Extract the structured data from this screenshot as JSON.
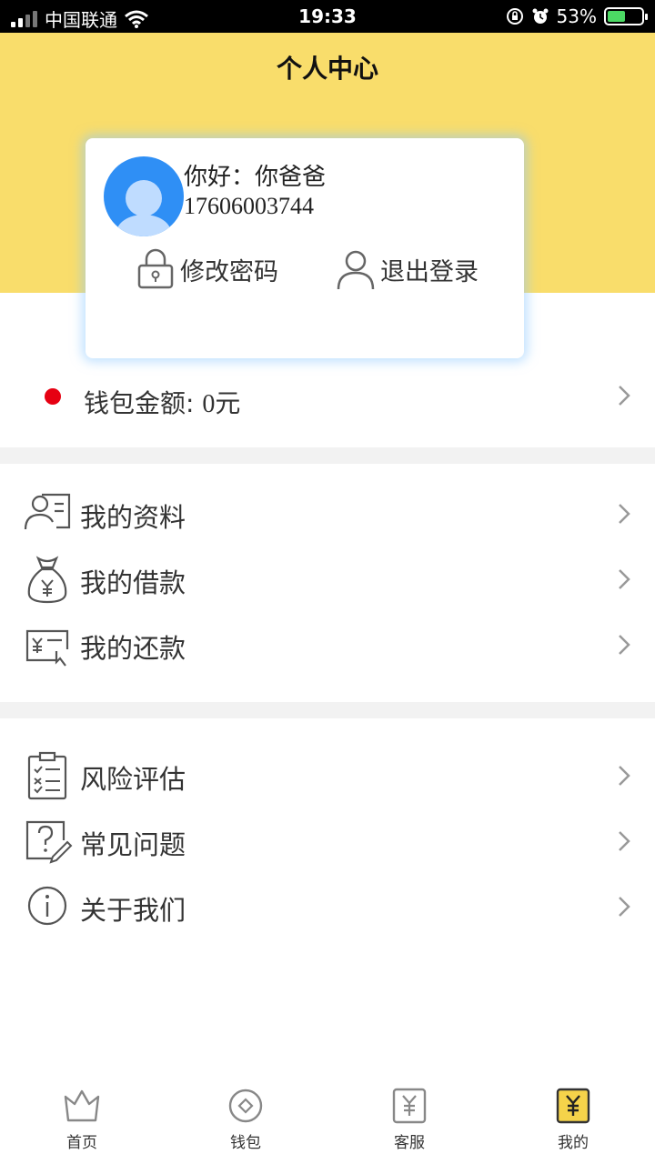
{
  "status_bar": {
    "carrier": "中国联通",
    "time": "19:33",
    "battery": "53%",
    "icons": [
      "signal-icon",
      "wifi-icon",
      "rotation-lock-icon",
      "alarm-icon",
      "battery-charging-icon"
    ]
  },
  "header": {
    "title": "个人中心",
    "bg_color": "#f9dd6b"
  },
  "profile": {
    "greeting": "你好：你爸爸",
    "phone": "17606003744",
    "change_password": "修改密码",
    "logout": "退出登录"
  },
  "wallet": {
    "label": "钱包金额: ",
    "amount": "0",
    "unit": "元",
    "dot_color": "#e60012"
  },
  "menu_group_1": [
    {
      "label": "我的资料",
      "icon": "profile-card-icon"
    },
    {
      "label": "我的借款",
      "icon": "money-bag-icon"
    },
    {
      "label": "我的还款",
      "icon": "repayment-icon"
    }
  ],
  "menu_group_2": [
    {
      "label": "风险评估",
      "icon": "clipboard-checklist-icon"
    },
    {
      "label": "常见问题",
      "icon": "question-icon"
    },
    {
      "label": "关于我们",
      "icon": "info-icon"
    }
  ],
  "tabbar": [
    {
      "label": "首页",
      "icon": "crown-icon"
    },
    {
      "label": "钱包",
      "icon": "wallet-coin-icon"
    },
    {
      "label": "客服",
      "icon": "service-yen-icon"
    },
    {
      "label": "我的",
      "icon": "my-yen-icon",
      "active": true
    }
  ]
}
